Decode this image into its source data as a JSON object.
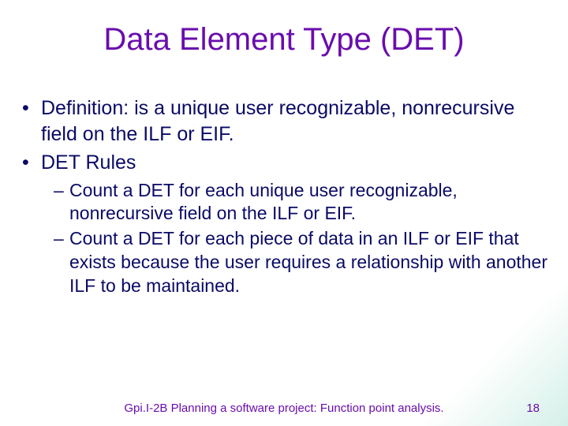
{
  "title": "Data Element Type (DET)",
  "bullets": [
    {
      "level": 1,
      "marker": "•",
      "text": "Definition: is a unique user recognizable, nonrecursive field on the ILF or EIF."
    },
    {
      "level": 1,
      "marker": "•",
      "text": "DET Rules"
    },
    {
      "level": 2,
      "marker": "–",
      "text": "Count a DET for each unique user recognizable, nonrecursive field on the ILF or EIF."
    },
    {
      "level": 2,
      "marker": "–",
      "text": "Count a DET for each piece of data in an ILF or EIF that exists because the user requires a relationship with another ILF to be maintained."
    }
  ],
  "footer": "Gpi.I-2B Planning a software project: Function point analysis.",
  "page": "18"
}
